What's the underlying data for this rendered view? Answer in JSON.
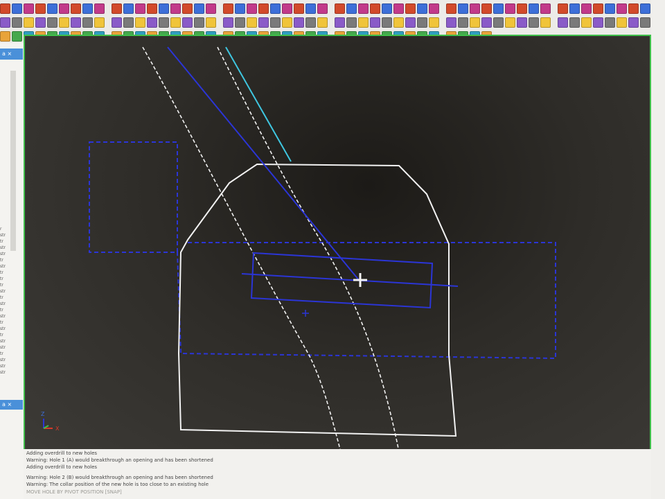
{
  "toolbar": {
    "rows": [
      {
        "buttons": 62
      },
      {
        "buttons": 70
      },
      {
        "buttons": 40
      }
    ]
  },
  "left_panel": {
    "tab_label": "a ×",
    "items": [
      "r",
      "str",
      "tr",
      "str",
      "str",
      "tr",
      "str",
      "tr",
      "tr",
      "tr",
      "str",
      "tr",
      "str",
      "tr",
      "str",
      "tr",
      "str",
      "tr",
      "str",
      "str",
      "tr",
      "str",
      "str",
      "str"
    ],
    "bottom_tab_label": "a ×"
  },
  "viewport": {
    "axis": {
      "z_label": "Z",
      "x_label": "X"
    },
    "colors": {
      "outline": "#f2f2f2",
      "selection": "#2b35d6",
      "cyan_line": "#3fc6e0",
      "frame": "#3fbf4a"
    }
  },
  "log": {
    "lines": [
      "Adding overdrill to new holes",
      "Warning: Hole 1 (A) would breakthrough an opening and has been shortened",
      "Adding overdrill to new holes",
      "Warning: Hole 2 (B) would breakthrough an opening and has been shortened",
      "Warning: The collar position of the new hole is too close to an existing hole"
    ],
    "prompt": "MOVE HOLE BY PIVOT POSITION [SNAP]"
  }
}
